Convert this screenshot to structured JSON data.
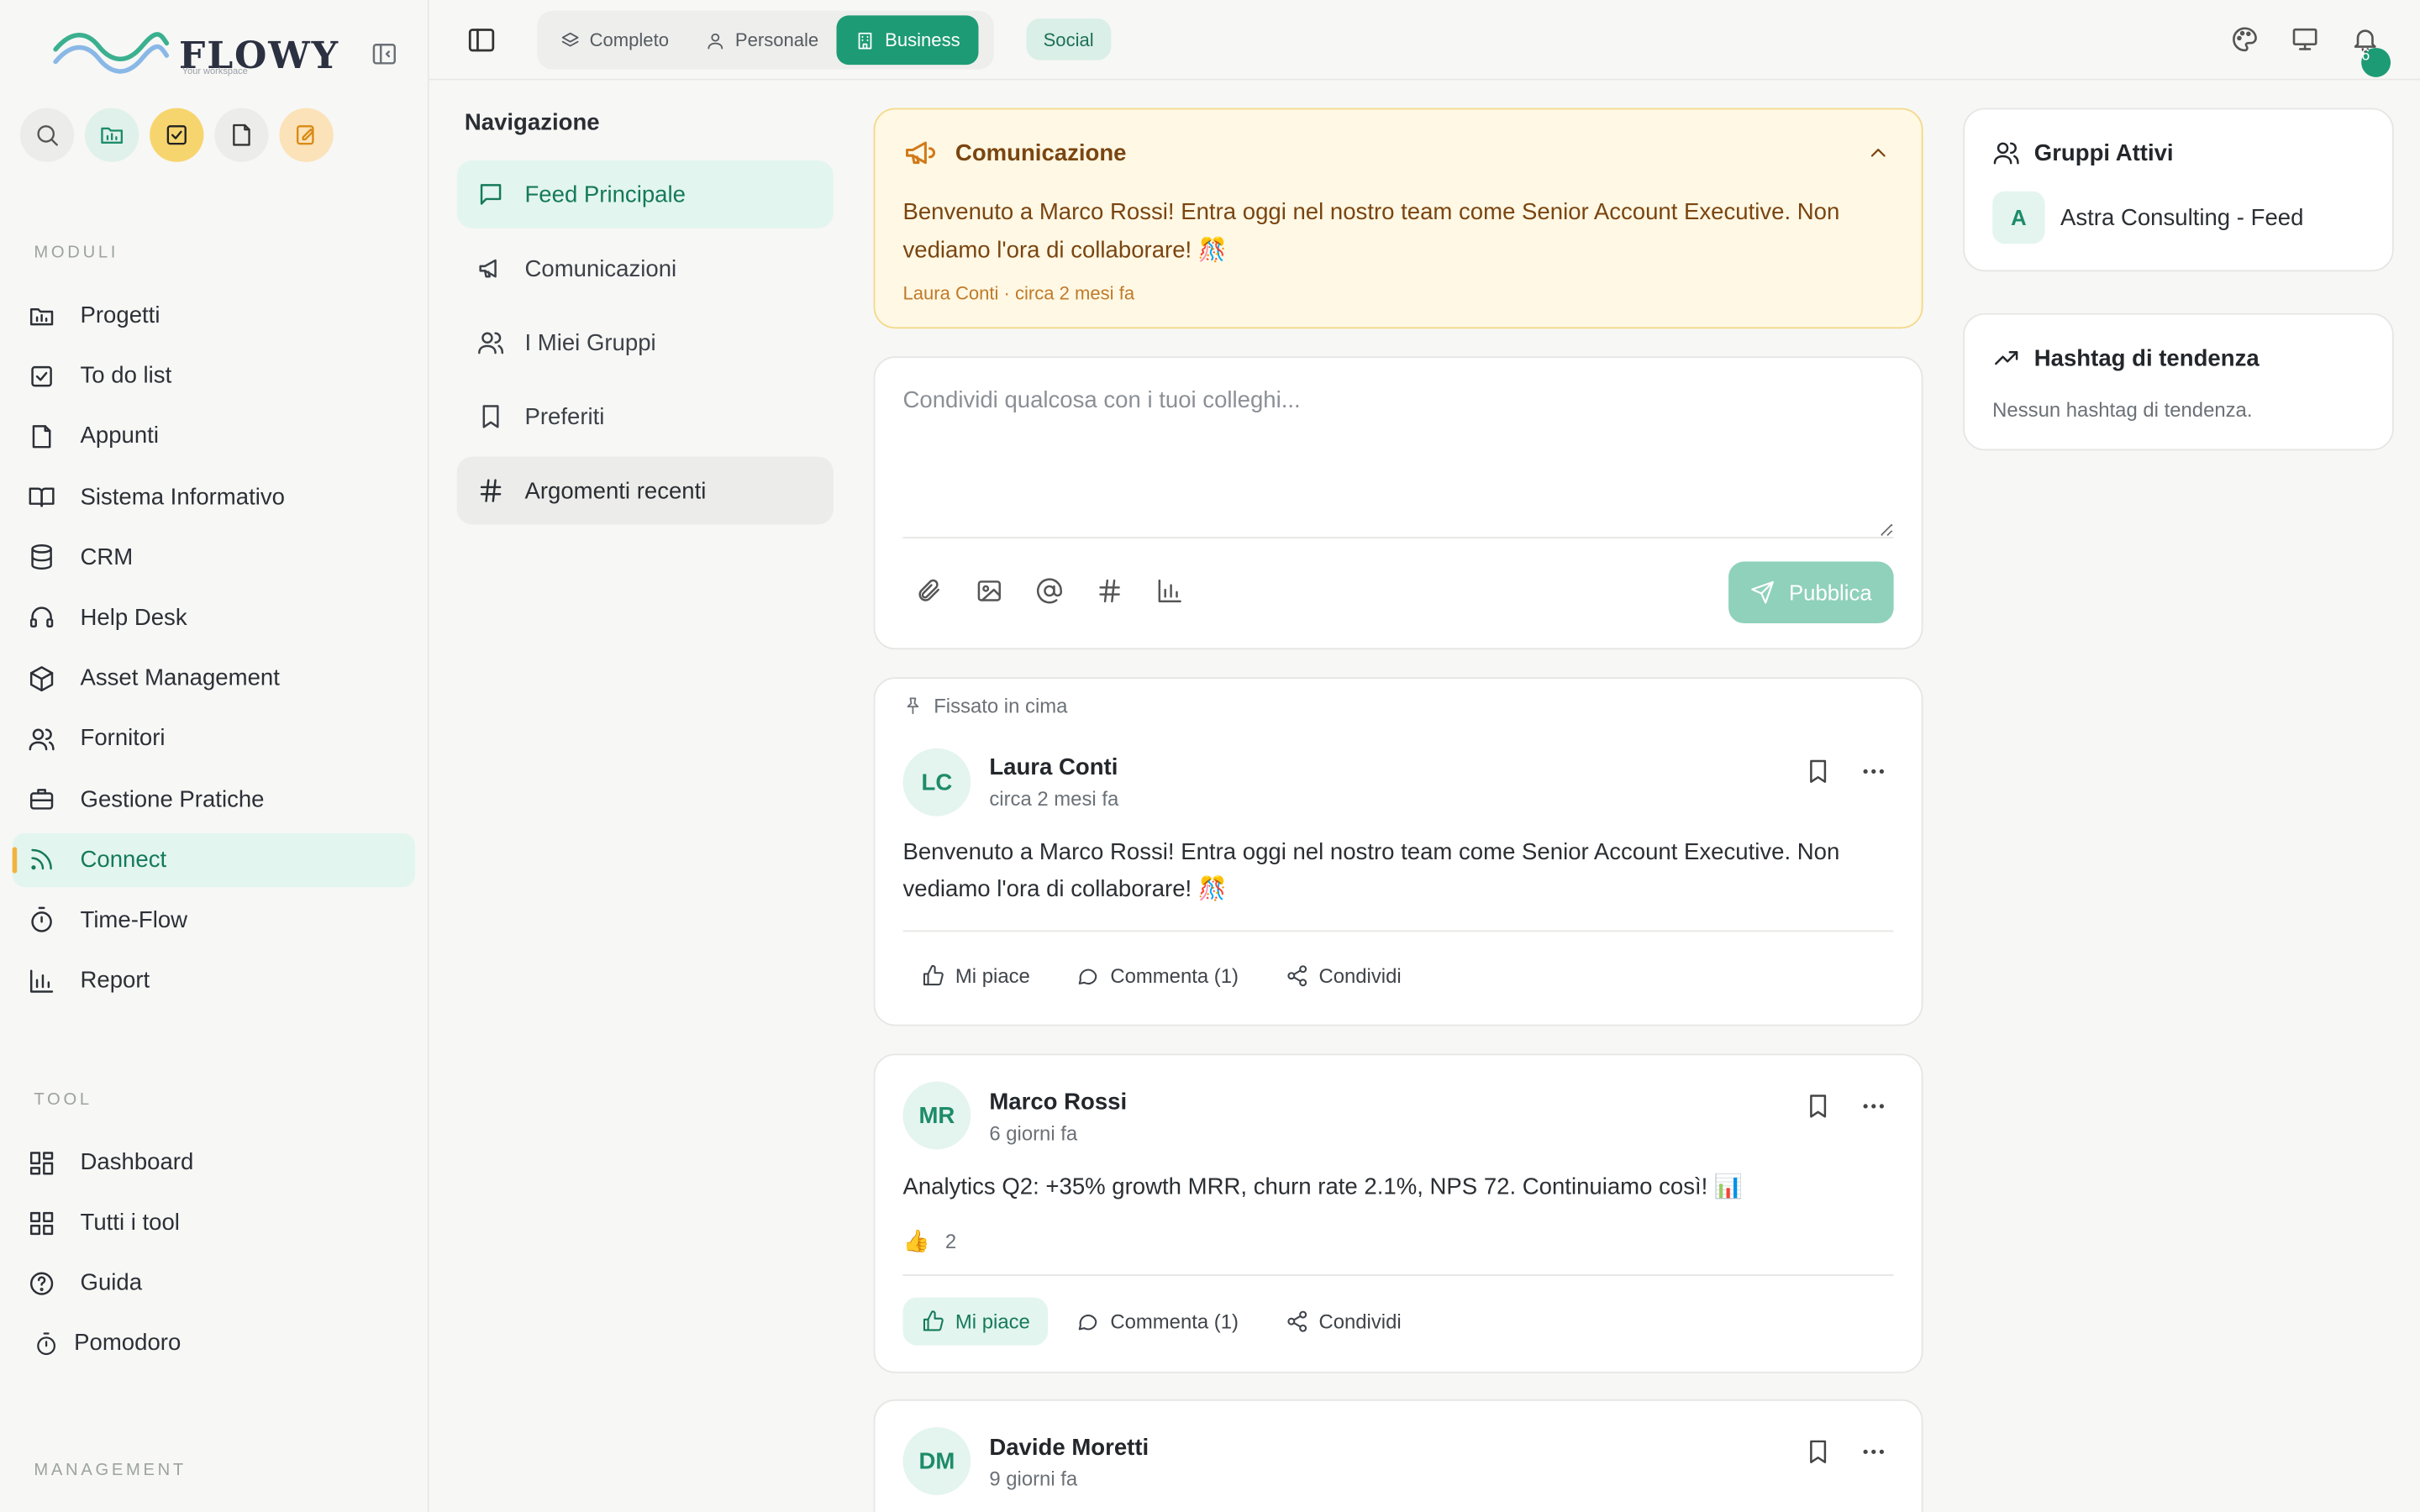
{
  "brand": {
    "name": "FLOWY",
    "tagline": "Your workspace"
  },
  "sidebar": {
    "modules_label": "MODULI",
    "modules": [
      {
        "label": "Progetti",
        "icon": "folder-chart-icon"
      },
      {
        "label": "To do list",
        "icon": "checkbox-icon"
      },
      {
        "label": "Appunti",
        "icon": "note-icon"
      },
      {
        "label": "Sistema Informativo",
        "icon": "book-icon"
      },
      {
        "label": "CRM",
        "icon": "database-icon"
      },
      {
        "label": "Help Desk",
        "icon": "headset-icon"
      },
      {
        "label": "Asset Management",
        "icon": "box-icon"
      },
      {
        "label": "Fornitori",
        "icon": "users-icon"
      },
      {
        "label": "Gestione Pratiche",
        "icon": "briefcase-icon"
      },
      {
        "label": "Connect",
        "icon": "rss-icon",
        "active": true
      },
      {
        "label": "Time-Flow",
        "icon": "timer-icon"
      },
      {
        "label": "Report",
        "icon": "bar-chart-icon"
      }
    ],
    "tool_label": "TOOL",
    "tools": [
      {
        "label": "Dashboard",
        "icon": "dashboard-icon"
      },
      {
        "label": "Tutti i tool",
        "icon": "grid-icon"
      },
      {
        "label": "Guida",
        "icon": "help-icon"
      }
    ],
    "pomodoro": "Pomodoro",
    "management_label": "MANAGEMENT"
  },
  "topbar": {
    "tabs": [
      {
        "label": "Completo",
        "icon": "layers-icon"
      },
      {
        "label": "Personale",
        "icon": "user-icon"
      },
      {
        "label": "Business",
        "icon": "building-icon",
        "active": true
      }
    ],
    "social": "Social",
    "notifications": "6"
  },
  "navigation": {
    "title": "Navigazione",
    "items": [
      {
        "label": "Feed Principale",
        "icon": "message-icon",
        "state": "active"
      },
      {
        "label": "Comunicazioni",
        "icon": "megaphone-icon"
      },
      {
        "label": "I Miei Gruppi",
        "icon": "users-icon"
      },
      {
        "label": "Preferiti",
        "icon": "bookmark-icon"
      },
      {
        "label": "Argomenti recenti",
        "icon": "hash-icon",
        "state": "hover"
      }
    ]
  },
  "announcement": {
    "title": "Comunicazione",
    "text": "Benvenuto a Marco Rossi! Entra oggi nel nostro team come Senior Account Executive. Non vediamo l'ora di collaborare! 🎊",
    "meta": "Laura Conti · circa 2 mesi fa"
  },
  "composer": {
    "placeholder": "Condividi qualcosa con i tuoi colleghi...",
    "publish": "Pubblica"
  },
  "posts": [
    {
      "pinned": "Fissato in cima",
      "initials": "LC",
      "author": "Laura Conti",
      "time": "circa 2 mesi fa",
      "text": "Benvenuto a Marco Rossi! Entra oggi nel nostro team come Senior Account Executive. Non vediamo l'ora di collaborare! 🎊",
      "like": "Mi piace",
      "comment": "Commenta (1)",
      "share": "Condividi"
    },
    {
      "initials": "MR",
      "author": "Marco Rossi",
      "time": "6 giorni fa",
      "text": "Analytics Q2: +35% growth MRR, churn rate 2.1%, NPS 72. Continuiamo così! 📊",
      "reactions": "2",
      "like": "Mi piace",
      "comment": "Commenta (1)",
      "share": "Condividi"
    },
    {
      "initials": "DM",
      "author": "Davide Moretti",
      "time": "9 giorni fa"
    }
  ],
  "right": {
    "groups_title": "Gruppi Attivi",
    "group_initial": "A",
    "group_name": "Astra Consulting - Feed",
    "trending_title": "Hashtag di tendenza",
    "trending_empty": "Nessun hashtag di tendenza."
  },
  "colors": {
    "accent": "#1d9b74",
    "accent_soft": "#e3f5ef",
    "warning_bg": "#fff8e4",
    "warning_text": "#7a4511"
  }
}
